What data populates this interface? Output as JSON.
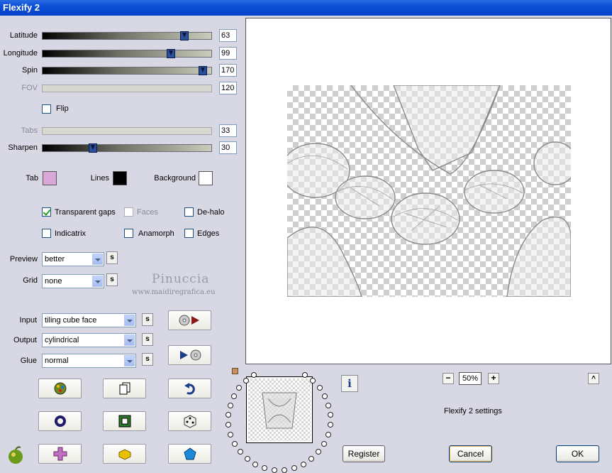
{
  "window": {
    "title": "Flexify 2"
  },
  "sliders": [
    {
      "label": "Latitude",
      "value": "63",
      "level": 0.84,
      "disabled": false
    },
    {
      "label": "Longitude",
      "value": "99",
      "level": 0.76,
      "disabled": false
    },
    {
      "label": "Spin",
      "value": "170",
      "level": 0.95,
      "disabled": false
    },
    {
      "label": "FOV",
      "value": "120",
      "level": null,
      "disabled": true
    },
    {
      "label": "Tabs",
      "value": "33",
      "level": null,
      "disabled": true
    },
    {
      "label": "Sharpen",
      "value": "30",
      "level": 0.3,
      "disabled": false
    }
  ],
  "flip": {
    "label": "Flip",
    "checked": false
  },
  "colors": {
    "tab_label": "Tab",
    "tab_color": "#d9a8d9",
    "lines_label": "Lines",
    "lines_color": "#000000",
    "background_label": "Background",
    "background_color": "#ffffff"
  },
  "options": {
    "transparent_gaps": {
      "label": "Transparent gaps",
      "checked": true
    },
    "faces": {
      "label": "Faces",
      "checked": false,
      "disabled": true
    },
    "de_halo": {
      "label": "De-halo",
      "checked": false
    },
    "indicatrix": {
      "label": "Indicatrix",
      "checked": false
    },
    "anamorph": {
      "label": "Anamorph",
      "checked": false
    },
    "edges": {
      "label": "Edges",
      "checked": false
    }
  },
  "preview_select": {
    "label": "Preview",
    "value": "better",
    "s": "s"
  },
  "grid_select": {
    "label": "Grid",
    "value": "none",
    "s": "s"
  },
  "watermark": {
    "name": "Pinuccia",
    "site": "www.maidiregrafica.eu"
  },
  "input_select": {
    "label": "Input",
    "value": "tiling cube face",
    "s": "s"
  },
  "output_select": {
    "label": "Output",
    "value": "cylindrical",
    "s": "s"
  },
  "glue_select": {
    "label": "Glue",
    "value": "normal",
    "s": "s"
  },
  "zoom": {
    "minus": "−",
    "value": "50%",
    "plus": "+"
  },
  "info_icon": "i",
  "settings_label": "Flexify 2 settings",
  "collapse_arrow": "^",
  "buttons": {
    "register": "Register",
    "cancel": "Cancel",
    "ok": "OK"
  },
  "accent_color": "#2a4f9c"
}
